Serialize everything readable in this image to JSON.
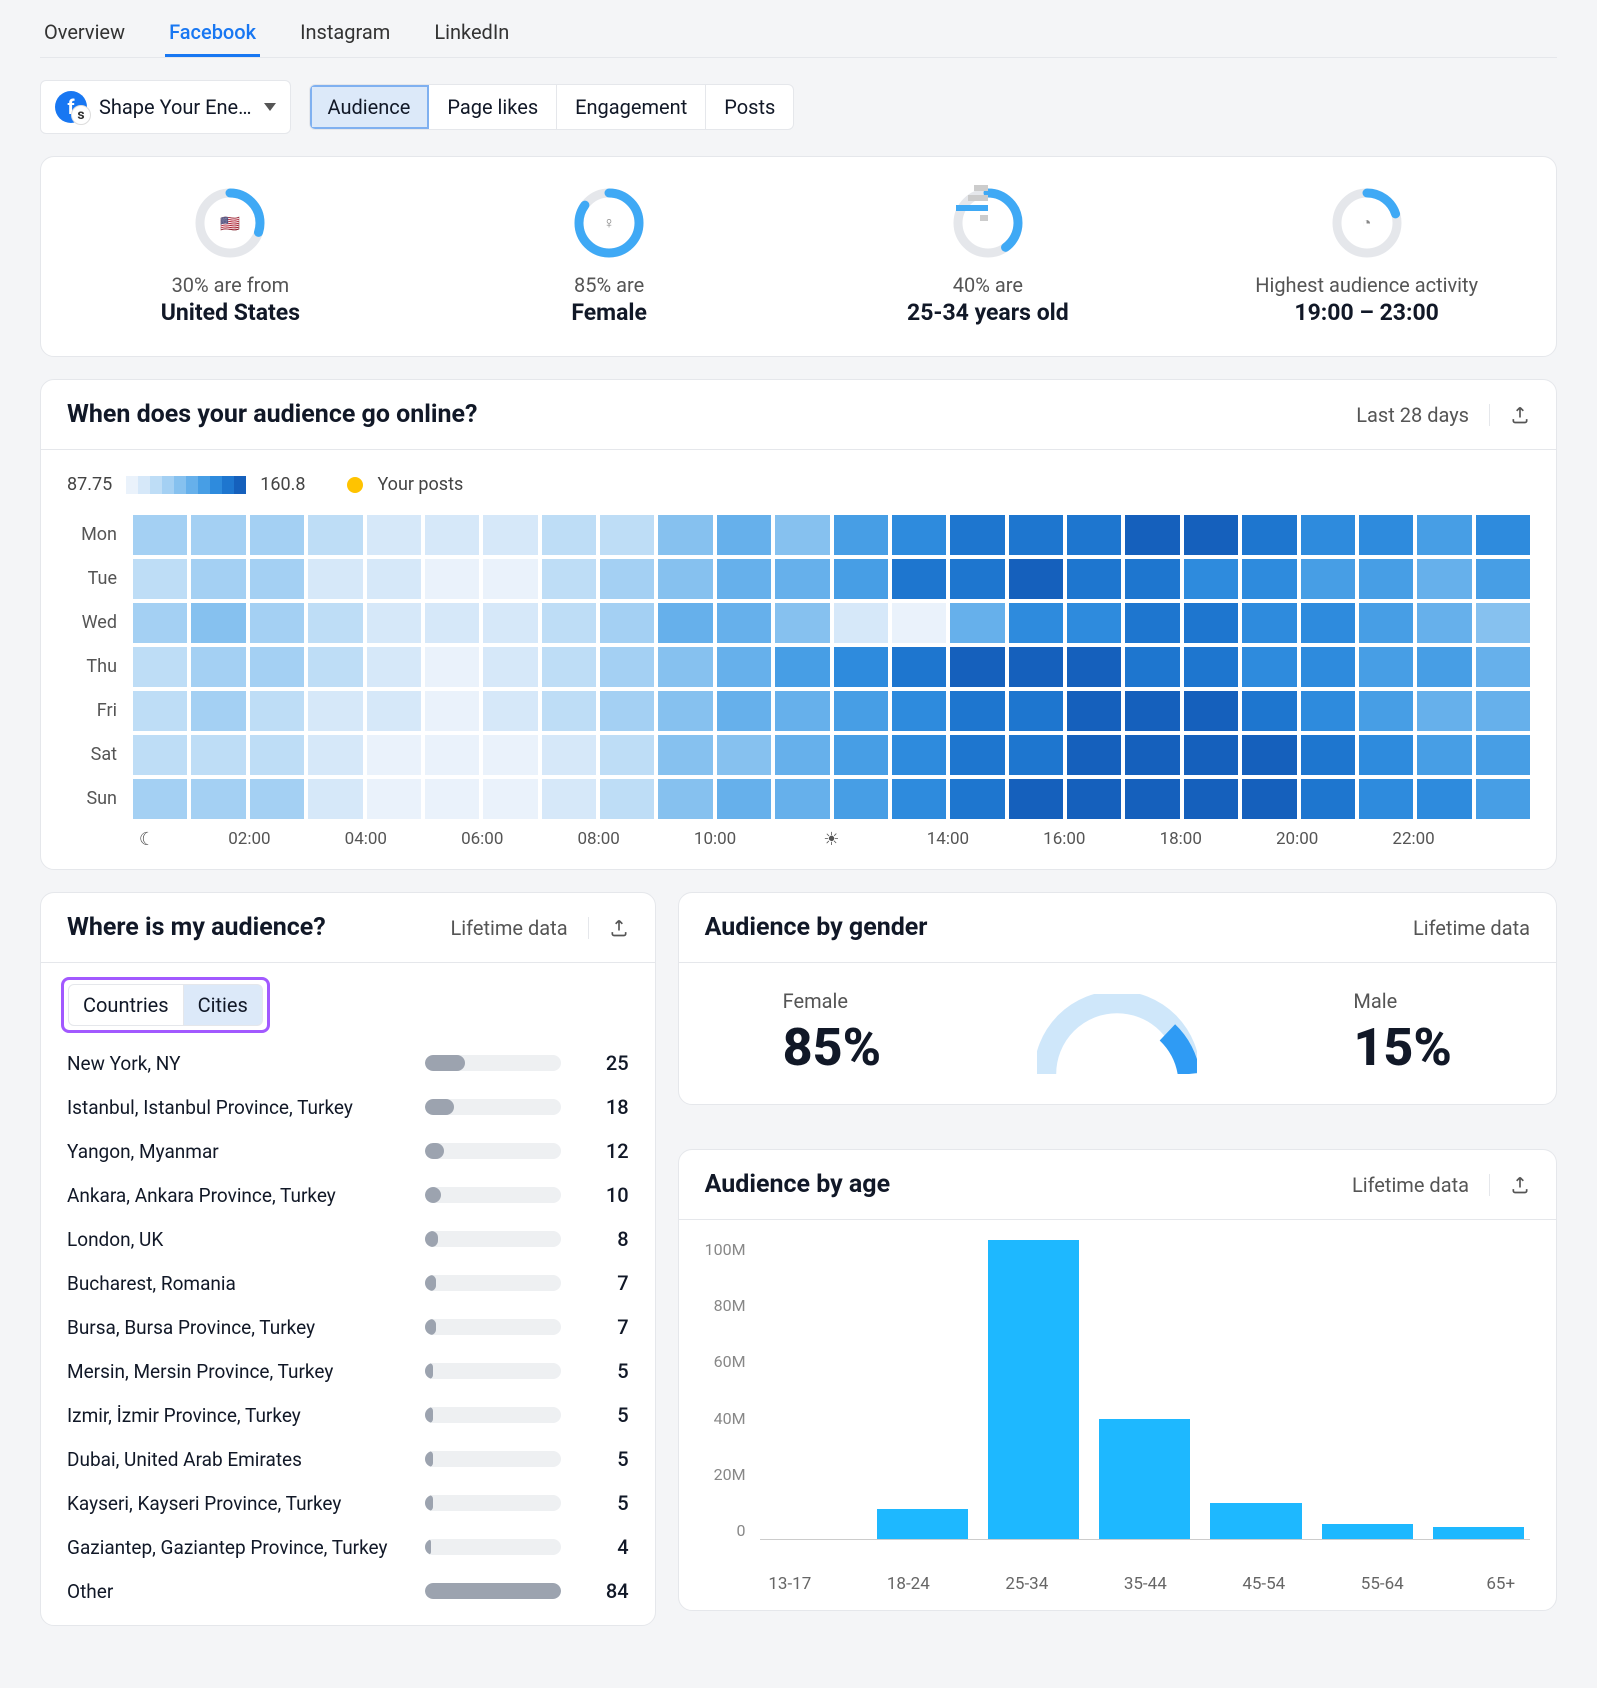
{
  "nav_tabs": [
    "Overview",
    "Facebook",
    "Instagram",
    "LinkedIn"
  ],
  "nav_active": 1,
  "page_selector": {
    "label": "Shape Your Ene…"
  },
  "subtabs": [
    "Audience",
    "Page likes",
    "Engagement",
    "Posts"
  ],
  "subtab_active": 0,
  "summary": [
    {
      "percent": 30,
      "sub": "30% are from",
      "val": "United States",
      "icon": "flag-us"
    },
    {
      "percent": 85,
      "sub": "85% are",
      "val": "Female",
      "icon": "female"
    },
    {
      "percent": 40,
      "sub": "40% are",
      "val": "25-34 years old",
      "icon": "bars"
    },
    {
      "percent": 20,
      "sub": "Highest audience activity",
      "val": "19:00 – 23:00",
      "icon": "clock"
    }
  ],
  "activity": {
    "title": "When does your audience go online?",
    "range_label": "Last 28 days",
    "scale_min": "87.75",
    "scale_max": "160.8",
    "your_posts_label": "Your posts",
    "days": [
      "Mon",
      "Tue",
      "Wed",
      "Thu",
      "Fri",
      "Sat",
      "Sun"
    ],
    "hour_labels": [
      "02:00",
      "04:00",
      "06:00",
      "08:00",
      "10:00",
      "14:00",
      "16:00",
      "18:00",
      "20:00",
      "22:00"
    ]
  },
  "audience_location": {
    "title": "Where is my audience?",
    "range_label": "Lifetime data",
    "toggle": [
      "Countries",
      "Cities"
    ],
    "toggle_active": 1,
    "rows": [
      {
        "label": "New York, NY",
        "value": 25
      },
      {
        "label": "Istanbul, Istanbul Province, Turkey",
        "value": 18
      },
      {
        "label": "Yangon, Myanmar",
        "value": 12
      },
      {
        "label": "Ankara, Ankara Province, Turkey",
        "value": 10
      },
      {
        "label": "London, UK",
        "value": 8
      },
      {
        "label": "Bucharest, Romania",
        "value": 7
      },
      {
        "label": "Bursa, Bursa Province, Turkey",
        "value": 7
      },
      {
        "label": "Mersin, Mersin Province, Turkey",
        "value": 5
      },
      {
        "label": "Izmir, İzmir Province, Turkey",
        "value": 5
      },
      {
        "label": "Dubai, United Arab Emirates",
        "value": 5
      },
      {
        "label": "Kayseri, Kayseri Province, Turkey",
        "value": 5
      },
      {
        "label": "Gaziantep, Gaziantep Province, Turkey",
        "value": 4
      },
      {
        "label": "Other",
        "value": 84
      }
    ]
  },
  "gender": {
    "title": "Audience by gender",
    "range_label": "Lifetime data",
    "female_label": "Female",
    "female_value": "85%",
    "male_label": "Male",
    "male_value": "15%"
  },
  "age": {
    "title": "Audience by age",
    "range_label": "Lifetime data"
  },
  "chart_data": [
    {
      "type": "heatmap",
      "title": "When does your audience go online?",
      "y_categories": [
        "Mon",
        "Tue",
        "Wed",
        "Thu",
        "Fri",
        "Sat",
        "Sun"
      ],
      "x_range_hours": [
        0,
        23
      ],
      "value_range": [
        87.75,
        160.8
      ],
      "note": "Activity intensity per hour/day over last 28 days",
      "values_rows": [
        [
          110,
          115,
          112,
          108,
          100,
          98,
          96,
          105,
          108,
          120,
          125,
          118,
          135,
          145,
          150,
          148,
          152,
          158,
          155,
          150,
          145,
          140,
          138,
          142
        ],
        [
          105,
          112,
          110,
          100,
          96,
          92,
          95,
          104,
          112,
          122,
          128,
          130,
          138,
          148,
          152,
          155,
          150,
          148,
          144,
          140,
          136,
          132,
          130,
          134
        ],
        [
          112,
          118,
          114,
          106,
          100,
          96,
          98,
          108,
          116,
          126,
          130,
          120,
          100,
          92,
          130,
          140,
          145,
          148,
          150,
          146,
          140,
          134,
          128,
          120
        ],
        [
          108,
          114,
          110,
          104,
          98,
          94,
          96,
          106,
          114,
          124,
          128,
          132,
          140,
          150,
          158,
          160,
          156,
          152,
          148,
          144,
          140,
          136,
          132,
          128
        ],
        [
          106,
          112,
          108,
          102,
          96,
          94,
          96,
          106,
          114,
          124,
          128,
          130,
          138,
          146,
          150,
          152,
          155,
          158,
          154,
          148,
          142,
          136,
          130,
          126
        ],
        [
          104,
          108,
          106,
          100,
          94,
          90,
          92,
          100,
          108,
          118,
          124,
          128,
          134,
          142,
          148,
          150,
          154,
          158,
          160,
          156,
          150,
          144,
          138,
          132
        ],
        [
          110,
          114,
          112,
          96,
          90,
          88,
          90,
          98,
          108,
          120,
          126,
          130,
          136,
          144,
          150,
          154,
          156,
          158,
          160,
          158,
          152,
          146,
          140,
          134
        ]
      ]
    },
    {
      "type": "pie",
      "title": "Audience by gender",
      "series": [
        {
          "name": "Female",
          "value": 85
        },
        {
          "name": "Male",
          "value": 15
        }
      ]
    },
    {
      "type": "bar",
      "title": "Audience by age",
      "ylabel": "",
      "ylim": [
        0,
        100000000
      ],
      "y_ticks": [
        0,
        "20M",
        "40M",
        "60M",
        "80M",
        "100M"
      ],
      "categories": [
        "13-17",
        "18-24",
        "25-34",
        "35-44",
        "45-54",
        "55-64",
        "65+"
      ],
      "values": [
        0,
        10000000,
        100000000,
        40000000,
        12000000,
        5000000,
        4000000
      ]
    }
  ]
}
